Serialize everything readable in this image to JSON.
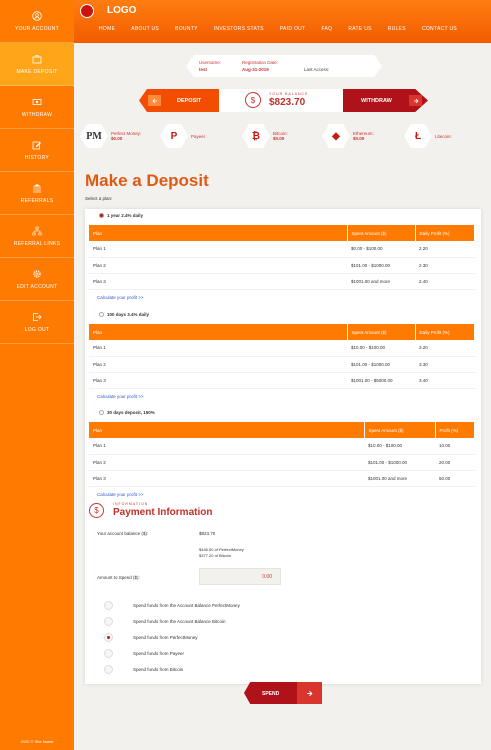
{
  "sidebar": {
    "items": [
      {
        "label": "YOUR ACCOUNT",
        "icon": "user-circle-icon"
      },
      {
        "label": "MAKE DEPOSIT",
        "icon": "briefcase-icon"
      },
      {
        "label": "WITHDRAW",
        "icon": "cash-icon"
      },
      {
        "label": "HISTORY",
        "icon": "edit-icon"
      },
      {
        "label": "REFERRALS",
        "icon": "bank-icon"
      },
      {
        "label": "REFERRAL LINKS",
        "icon": "network-icon"
      },
      {
        "label": "EDIT ACCOUNT",
        "icon": "gear-icon"
      },
      {
        "label": "LOG OUT",
        "icon": "logout-icon"
      }
    ],
    "copyright": "2020 © Site Name"
  },
  "header": {
    "logo": "LOGO",
    "nav": [
      "HOME",
      "ABOUT US",
      "BOUNTY",
      "INVESTORS STATS",
      "PAID OUT",
      "FAQ",
      "RATE US",
      "RULES",
      "CONTACT US"
    ]
  },
  "user": {
    "username_label": "Username:",
    "username": "test",
    "reg_label": "Registration Date:",
    "reg_date": "Aug-31-2019",
    "last_access_label": "Last Access:"
  },
  "balance": {
    "deposit_label": "DEPOSIT",
    "withdraw_label": "WITHDRAW",
    "label": "YOUR BALANCE",
    "value": "$823.70"
  },
  "wallets": [
    {
      "name": "Perfect Money:",
      "amount": "$0.00",
      "icon": "PM"
    },
    {
      "name": "Payeer",
      "amount": "",
      "icon": "P"
    },
    {
      "name": "Bitcoin:",
      "amount": "$0.00",
      "icon": "₿"
    },
    {
      "name": "Ethereum:",
      "amount": "$0.00",
      "icon": "◆"
    },
    {
      "name": "Litecoin:",
      "amount": "",
      "icon": "Ł"
    }
  ],
  "page": {
    "title": "Make a Deposit",
    "select_plan": "Select a plan:"
  },
  "plans": [
    {
      "name": "1 year 2.4% daily",
      "headers": [
        "Plan",
        "Spent Amount ($)",
        "Daily Profit (%)"
      ],
      "rows": [
        [
          "Plan 1",
          "$0.00 - $100.00",
          "2.20"
        ],
        [
          "Plan 2",
          "$101.00 - $1000.00",
          "2.30"
        ],
        [
          "Plan 3",
          "$1001.00 and more",
          "2.40"
        ]
      ],
      "calc": "Calculate your profit >>"
    },
    {
      "name": "100 days 3.4% daily",
      "headers": [
        "Plan",
        "Spent Amount ($)",
        "Daily Profit (%)"
      ],
      "rows": [
        [
          "Plan 1",
          "$10.00 - $100.00",
          "3.20"
        ],
        [
          "Plan 2",
          "$101.00 - $1000.00",
          "3.30"
        ],
        [
          "Plan 3",
          "$1001.00 - $5000.00",
          "3.40"
        ]
      ],
      "calc": "Calculate your profit >>"
    },
    {
      "name": "30 days deposit, 150%",
      "headers": [
        "Plan",
        "Spent Amount ($)",
        "Profit (%)"
      ],
      "rows": [
        [
          "Plan 1",
          "$10.00 - $100.00",
          "10.00"
        ],
        [
          "Plan 2",
          "$101.00 - $1000.00",
          "20.00"
        ],
        [
          "Plan 3",
          "$1001.00 and more",
          "50.00"
        ]
      ],
      "calc": "Calculate your profit >>"
    }
  ],
  "payment": {
    "subtitle": "INFORMATION",
    "title": "Payment Information",
    "balance_label": "Your account balance ($):",
    "balance_value": "$823.70",
    "pm_detail": "$446.50 of PerfectMoney",
    "btc_detail": "$377.20 of Bitcoin",
    "amount_label": "Amount to Spend ($):",
    "amount_value": "0.00",
    "options": [
      "Spend funds from the Account Balance PerfectMoney",
      "Spend funds from the Account Balance Bitcoin",
      "Spend funds from PerfectMoney",
      "Spend funds from Payeer",
      "Spend funds from Bitcoin"
    ],
    "selected_option": 2,
    "spend_label": "SPEND"
  },
  "colors": {
    "accent": "#ff7a00",
    "dark_red": "#b0121a",
    "title": "#e05a14"
  }
}
